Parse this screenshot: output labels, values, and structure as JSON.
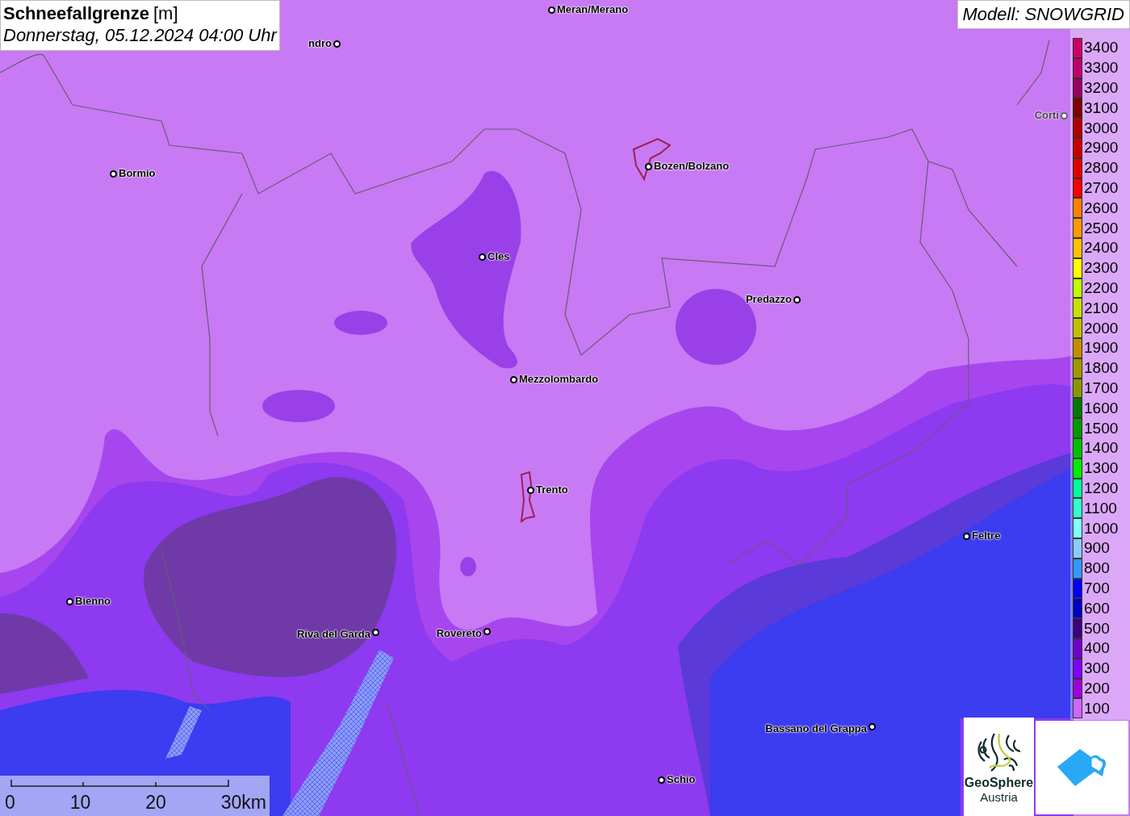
{
  "title": {
    "heading": "Schneefallgrenze",
    "unit": "[m]",
    "datetime": "Donnerstag, 05.12.2024 04:00 Uhr"
  },
  "model": "Modell: SNOWGRID",
  "cities": [
    {
      "label": "ndro"
    },
    {
      "label": "Meran/Merano"
    },
    {
      "label": "Bormio"
    },
    {
      "label": "Bozen/Bolzano"
    },
    {
      "label": "Corti"
    },
    {
      "label": "Cles"
    },
    {
      "label": "Predazzo"
    },
    {
      "label": "Mezzolombardo"
    },
    {
      "label": "Trento"
    },
    {
      "label": "Feltre"
    },
    {
      "label": "Bienno"
    },
    {
      "label": "Riva del Garda"
    },
    {
      "label": "Rovereto"
    },
    {
      "label": "Bassano del Grappa"
    },
    {
      "label": "Schio"
    }
  ],
  "legend": [
    {
      "label": "3400",
      "color": "#cc0066"
    },
    {
      "label": "3300",
      "color": "#c0006e"
    },
    {
      "label": "3200",
      "color": "#990066"
    },
    {
      "label": "3100",
      "color": "#800000"
    },
    {
      "label": "3000",
      "color": "#b00000"
    },
    {
      "label": "2900",
      "color": "#c80000"
    },
    {
      "label": "2800",
      "color": "#e00000"
    },
    {
      "label": "2700",
      "color": "#ff0000"
    },
    {
      "label": "2600",
      "color": "#ff8000"
    },
    {
      "label": "2500",
      "color": "#ff9900"
    },
    {
      "label": "2400",
      "color": "#ffc000"
    },
    {
      "label": "2300",
      "color": "#ffff00"
    },
    {
      "label": "2200",
      "color": "#c0ff00"
    },
    {
      "label": "2100",
      "color": "#c8e000"
    },
    {
      "label": "2000",
      "color": "#c0c000"
    },
    {
      "label": "1900",
      "color": "#c09000"
    },
    {
      "label": "1800",
      "color": "#a09900"
    },
    {
      "label": "1700",
      "color": "#889900"
    },
    {
      "label": "1600",
      "color": "#007700"
    },
    {
      "label": "1500",
      "color": "#009900"
    },
    {
      "label": "1400",
      "color": "#00c000"
    },
    {
      "label": "1300",
      "color": "#00ee00"
    },
    {
      "label": "1200",
      "color": "#00ff99"
    },
    {
      "label": "1100",
      "color": "#33ffcc"
    },
    {
      "label": "1000",
      "color": "#80ffff"
    },
    {
      "label": "900",
      "color": "#88ccff"
    },
    {
      "label": "800",
      "color": "#3399ff"
    },
    {
      "label": "700",
      "color": "#0000ff"
    },
    {
      "label": "600",
      "color": "#0000c0"
    },
    {
      "label": "500",
      "color": "#3c0080"
    },
    {
      "label": "400",
      "color": "#7000c8"
    },
    {
      "label": "300",
      "color": "#8000ff"
    },
    {
      "label": "200",
      "color": "#a000d8"
    },
    {
      "label": "100",
      "color": "#cc66ff"
    }
  ],
  "scale_bar": [
    "0",
    "10",
    "20",
    "30km"
  ],
  "logo": {
    "name": "GeoSphere",
    "subtitle": "Austria"
  }
}
